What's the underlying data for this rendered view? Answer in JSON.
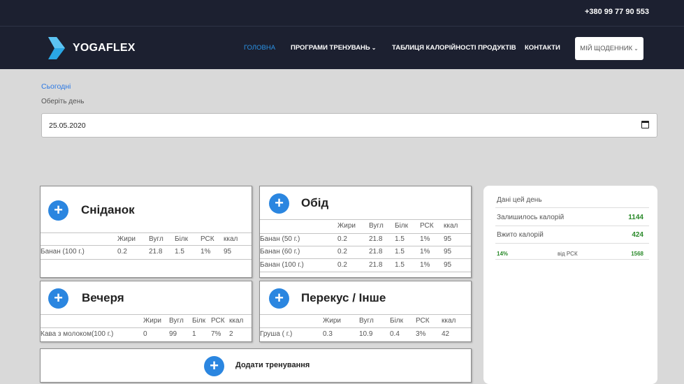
{
  "header": {
    "phone": "+380 99 77 90 553",
    "brand": "YOGAFLEX"
  },
  "nav": {
    "home": "ГОЛОВНА",
    "programs": "ПРОГРАМИ ТРЕНУВАНЬ",
    "calories_table": "ТАБЛИЦЯ КАЛОРІЙНОСТІ ПРОДУКТІВ",
    "contacts": "КОНТАКТИ",
    "diary": "МІЙ ЩОДЕННИК"
  },
  "date_picker": {
    "today_link": "Сьогодні",
    "label": "Оберіть день",
    "value": "25.05.2020"
  },
  "columns": [
    "Жири",
    "Вугл",
    "Білк",
    "РСК",
    "ккал"
  ],
  "meals": {
    "breakfast": {
      "title": "Сніданок",
      "rows": [
        {
          "name": "Банан (100 г.)",
          "fat": "0.2",
          "carbs": "21.8",
          "protein": "1.5",
          "rsk": "1%",
          "kcal": "95"
        }
      ]
    },
    "lunch": {
      "title": "Обід",
      "rows": [
        {
          "name": "Банан (50 г.)",
          "fat": "0.2",
          "carbs": "21.8",
          "protein": "1.5",
          "rsk": "1%",
          "kcal": "95"
        },
        {
          "name": "Банан (60 г.)",
          "fat": "0.2",
          "carbs": "21.8",
          "protein": "1.5",
          "rsk": "1%",
          "kcal": "95"
        },
        {
          "name": "Банан (100 г.)",
          "fat": "0.2",
          "carbs": "21.8",
          "protein": "1.5",
          "rsk": "1%",
          "kcal": "95"
        }
      ]
    },
    "dinner": {
      "title": "Вечеря",
      "rows": [
        {
          "name": "Кава з молоком(100 г.)",
          "fat": "0",
          "carbs": "99",
          "protein": "1",
          "rsk": "7%",
          "kcal": "2"
        }
      ]
    },
    "snack": {
      "title": "Перекус / Інше",
      "rows": [
        {
          "name": "Груша ( г.)",
          "fat": "0.3",
          "carbs": "10.9",
          "protein": "0.4",
          "rsk": "3%",
          "kcal": "42"
        }
      ]
    }
  },
  "add_training": "Додати тренування",
  "summary": {
    "title": "Дані цей день",
    "remaining_label": "Залишилось калорій",
    "remaining_value": "1144",
    "consumed_label": "Вжито калорій",
    "consumed_value": "424",
    "percent": "14%",
    "of_rsk_label": "від РСК",
    "rsk_value": "1568"
  },
  "colors": {
    "navbar": "#1c2030",
    "accent": "#2b86e0",
    "positive": "#2a8a2a"
  }
}
